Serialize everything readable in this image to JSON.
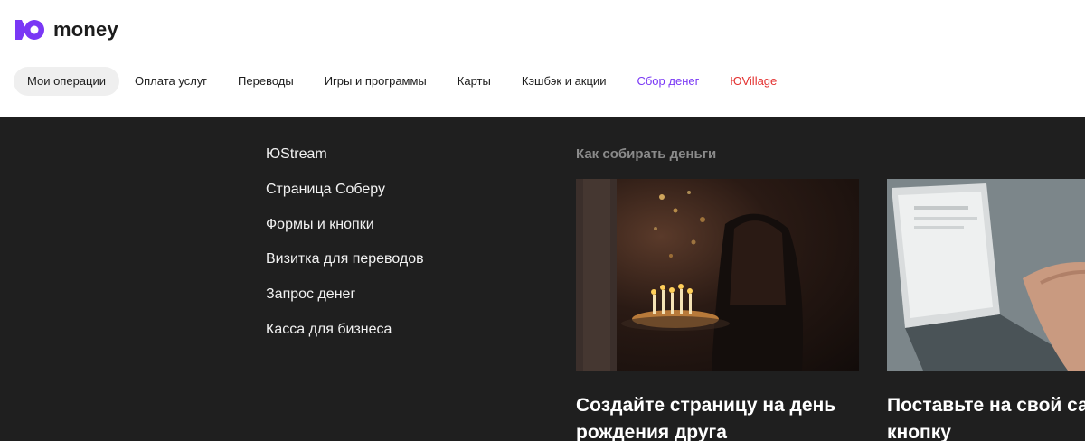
{
  "brand": {
    "name": "money",
    "accent": "#7a38f5"
  },
  "nav": {
    "items": [
      {
        "label": "Мои операции",
        "active": true
      },
      {
        "label": "Оплата услуг"
      },
      {
        "label": "Переводы"
      },
      {
        "label": "Игры и программы"
      },
      {
        "label": "Карты"
      },
      {
        "label": "Кэшбэк и акции"
      },
      {
        "label": "Сбор денег",
        "color": "#7a38f5"
      },
      {
        "label": "ЮVillage",
        "color": "#e3302f"
      }
    ]
  },
  "dropdown": {
    "menu": [
      {
        "label": "ЮStream"
      },
      {
        "label": "Страница Соберу"
      },
      {
        "label": "Формы и кнопки"
      },
      {
        "label": "Визитка для переводов"
      },
      {
        "label": "Запрос денег"
      },
      {
        "label": "Касса для бизнеса"
      }
    ],
    "articles_title": "Как собирать деньги",
    "articles": [
      {
        "title": "Создайте страницу на день рождения друга",
        "image": "birthday-cake-photo"
      },
      {
        "title": "Поставьте на свой сайт нашу кнопку",
        "image": "laptop-typing-photo"
      }
    ]
  }
}
